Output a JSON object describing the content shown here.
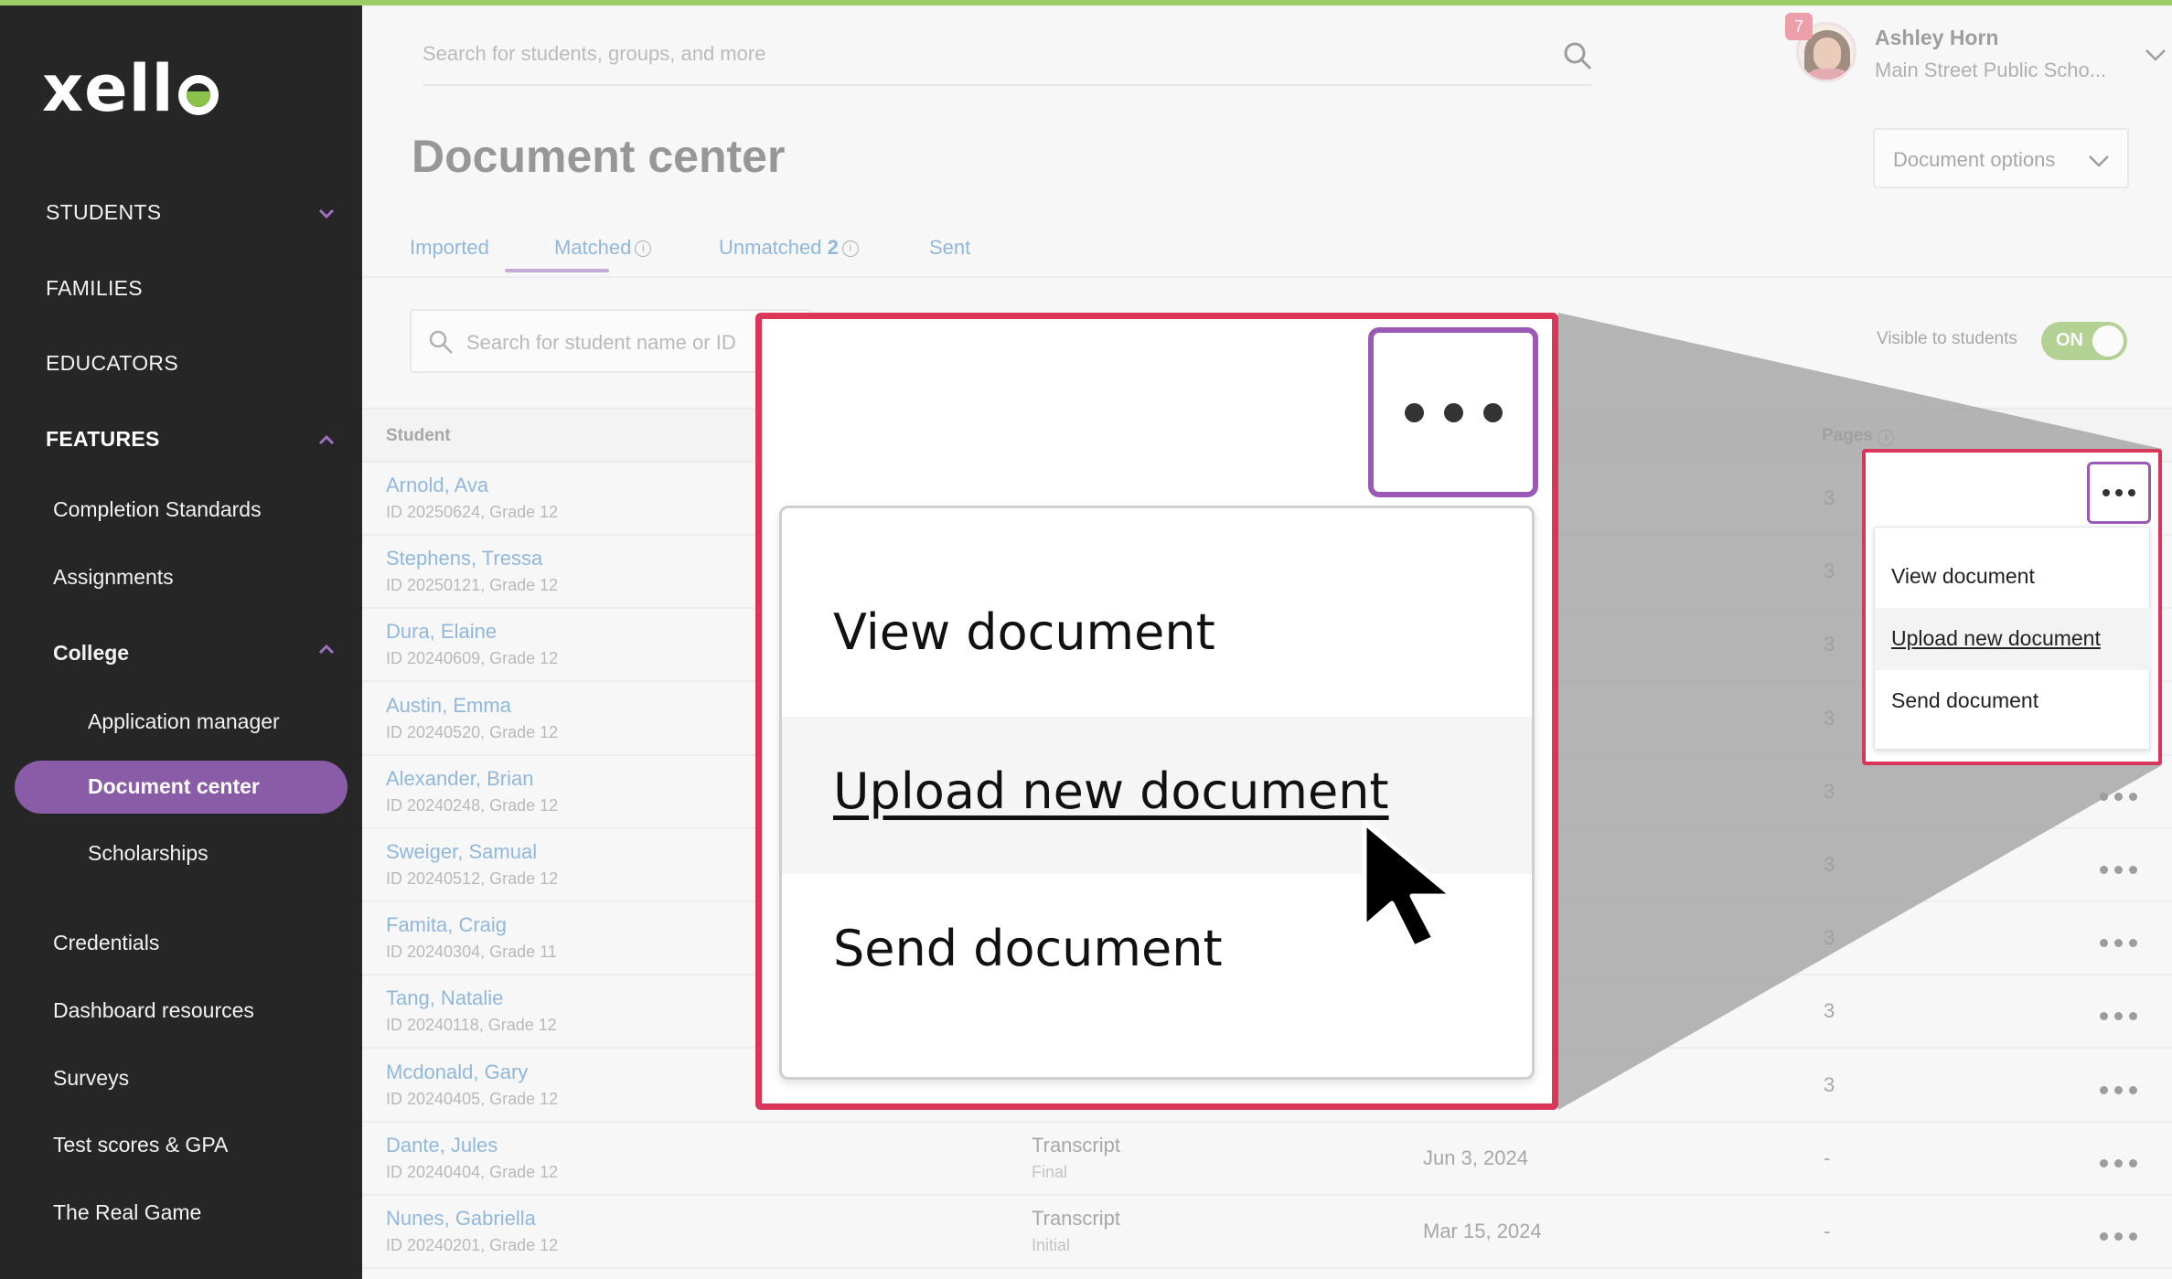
{
  "app": {
    "brand": "xello",
    "accent_color": "#8a5ca7",
    "highlight_color": "#d9365a"
  },
  "sidebar": {
    "items": [
      {
        "label": "STUDENTS",
        "icon": "chevron-down-icon"
      },
      {
        "label": "FAMILIES"
      },
      {
        "label": "EDUCATORS"
      },
      {
        "label": "FEATURES",
        "icon": "chevron-up-icon"
      },
      {
        "label": "Completion Standards"
      },
      {
        "label": "Assignments"
      },
      {
        "label": "College",
        "icon": "chevron-up-icon"
      },
      {
        "label": "Application manager"
      },
      {
        "label": "Document center",
        "active": true
      },
      {
        "label": "Scholarships"
      },
      {
        "label": "Credentials"
      },
      {
        "label": "Dashboard resources"
      },
      {
        "label": "Surveys"
      },
      {
        "label": "Test scores & GPA"
      },
      {
        "label": "The Real Game"
      }
    ]
  },
  "header": {
    "search_placeholder": "Search for students, groups, and more",
    "notification_count": "7",
    "user_name": "Ashley Horn",
    "user_school": "Main Street Public Scho..."
  },
  "page": {
    "title": "Document center",
    "options_label": "Document options",
    "tabs": [
      {
        "label": "Imported"
      },
      {
        "label": "Matched",
        "active": true
      },
      {
        "label": "Unmatched",
        "count": "2"
      },
      {
        "label": "Sent"
      }
    ],
    "student_search_placeholder": "Search for student name or ID",
    "visible_label": "Visible to students",
    "toggle_label": "ON"
  },
  "table": {
    "headers": {
      "student": "Student",
      "pages": "Pages"
    },
    "rows": [
      {
        "name": "Arnold, Ava",
        "id": "ID 20250624, Grade 12",
        "pages": "3"
      },
      {
        "name": "Stephens, Tressa",
        "id": "ID 20250121, Grade 12",
        "pages": "3"
      },
      {
        "name": "Dura, Elaine",
        "id": "ID 20240609, Grade 12",
        "pages": "3"
      },
      {
        "name": "Austin, Emma",
        "id": "ID 20240520, Grade 12",
        "pages": "3"
      },
      {
        "name": "Alexander, Brian",
        "id": "ID 20240248, Grade 12",
        "pages": "3"
      },
      {
        "name": "Sweiger, Samual",
        "id": "ID 20240512, Grade 12",
        "pages": "3"
      },
      {
        "name": "Famita, Craig",
        "id": "ID 20240304, Grade 11",
        "pages": "3"
      },
      {
        "name": "Tang, Natalie",
        "id": "ID 20240118, Grade 12",
        "pages": "3"
      },
      {
        "name": "Mcdonald, Gary",
        "id": "ID 20240405, Grade 12",
        "pages": "3"
      },
      {
        "name": "Dante, Jules",
        "id": "ID 20240404, Grade 12",
        "doc_type": "Transcript",
        "doc_sub": "Final",
        "date": "Jun 3, 2024",
        "pages": "-"
      },
      {
        "name": "Nunes, Gabriella",
        "id": "ID 20240201, Grade 12",
        "doc_type": "Transcript",
        "doc_sub": "Initial",
        "date": "Mar 15, 2024",
        "pages": "-"
      }
    ]
  },
  "menu": {
    "items": [
      "View document",
      "Upload new document",
      "Send document"
    ]
  }
}
